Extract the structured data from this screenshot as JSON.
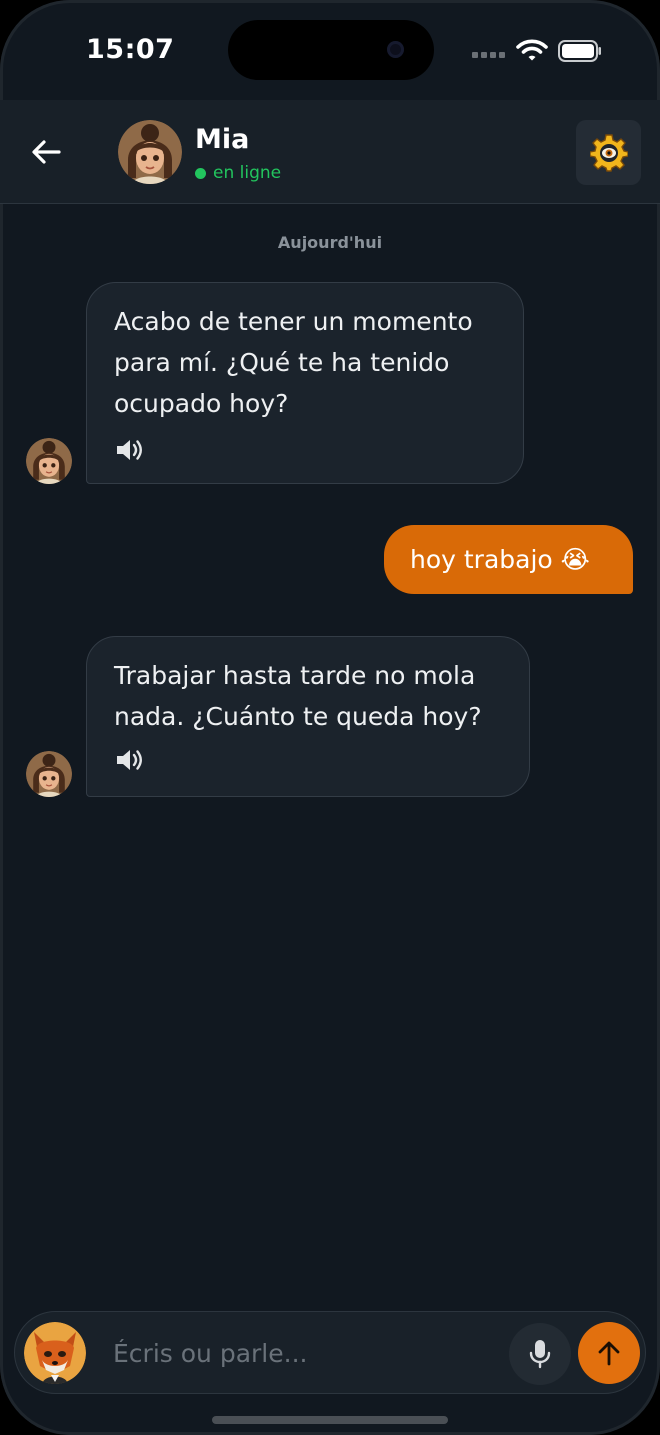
{
  "status_bar": {
    "time": "15:07"
  },
  "header": {
    "contact_name": "Mia",
    "presence": "en ligne"
  },
  "chat": {
    "day_label": "Aujourd'hui",
    "messages": [
      {
        "from": "Mia",
        "text": "Acabo de tener un momento para mí. ¿Qué te ha tenido ocupado hoy?"
      },
      {
        "from": "me",
        "text": "hoy trabajo 😭"
      },
      {
        "from": "Mia",
        "text": "Trabajar hasta tarde no mola nada. ¿Cuánto te queda hoy?"
      }
    ]
  },
  "composer": {
    "placeholder": "Écris ou parle..."
  },
  "colors": {
    "background": "#111820",
    "accent": "#d96a07",
    "online": "#22c55e",
    "bubble_in": "#1b232c"
  },
  "icons": {
    "back": "arrow-left-icon",
    "settings": "gear-icon",
    "speaker": "speaker-icon",
    "mic": "microphone-icon",
    "send": "arrow-up-icon"
  }
}
